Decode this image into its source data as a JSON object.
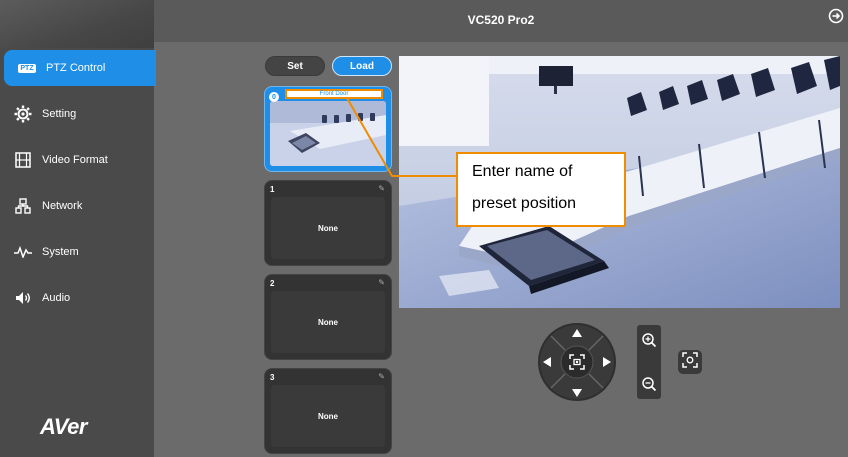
{
  "header": {
    "title": "VC520 Pro2"
  },
  "sidebar": {
    "ptz_badge": "PTZ",
    "items": [
      {
        "label": "PTZ Control",
        "icon": "ptz-icon"
      },
      {
        "label": "Setting",
        "icon": "gear-icon"
      },
      {
        "label": "Video Format",
        "icon": "film-icon"
      },
      {
        "label": "Network",
        "icon": "network-icon"
      },
      {
        "label": "System",
        "icon": "pulse-icon"
      },
      {
        "label": "Audio",
        "icon": "speaker-icon"
      }
    ],
    "logo": "AVer"
  },
  "toolbar": {
    "set_label": "Set",
    "load_label": "Load"
  },
  "presets": [
    {
      "number": "0",
      "name": "Front Door"
    },
    {
      "number": "1",
      "name": "None"
    },
    {
      "number": "2",
      "name": "None"
    },
    {
      "number": "3",
      "name": "None"
    }
  ],
  "callout": {
    "line1": "Enter name of",
    "line2": "preset position"
  },
  "colors": {
    "accent": "#1e8ee6",
    "callout_border": "#f08c00",
    "background": "#6b6b6b"
  }
}
